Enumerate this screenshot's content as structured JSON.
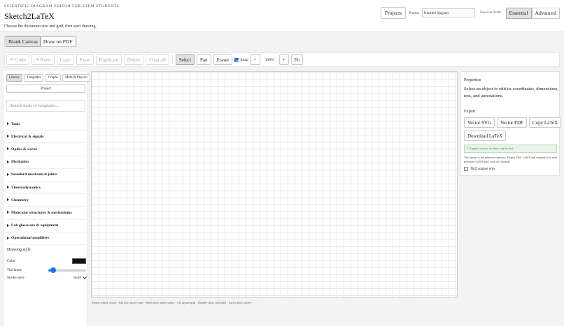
{
  "header": {
    "eyebrow": "SCIENTIFIC DIAGRAM EDITOR FOR STEM STUDENTS",
    "title": "Sketch2LaTeX",
    "instruction": "Choose the document size and grid, then start drawing.",
    "projects_button": "Projects",
    "project_label": "Project",
    "project_name": "Untitled diagram",
    "saved_status": "Saved at 01:00",
    "mode_essential": "Essential",
    "mode_advanced": "Advanced"
  },
  "canvas_mode": {
    "tabs": [
      "Blank Canvas",
      "Draw on PDF"
    ],
    "selected": "Blank Canvas"
  },
  "toolbar": {
    "undo": "↶ Undo",
    "redo": "↷ Redo",
    "copy": "Copy",
    "paste": "Paste",
    "duplicate": "Duplicate",
    "delete": "Delete",
    "clear_all": "Clear all",
    "select": "Select",
    "pan": "Pan",
    "eraser": "Eraser",
    "snap_label": "Snap",
    "snap_checked": true,
    "zoom_out": "−",
    "zoom_level": "100%",
    "zoom_in": "+",
    "fit": "Fit"
  },
  "sidebar": {
    "tabs": [
      "Library",
      "Templates",
      "Graphs",
      "Math & Physics"
    ],
    "project_tab": "Project",
    "search_placeholder": "Search tools or templates…",
    "categories": [
      "Tools",
      "Electrical & signals",
      "Optics & waves",
      "Mechanics",
      "Standard mechanical joints",
      "Thermodynamics",
      "Chemistry",
      "Molecular structures & mechanisms",
      "Lab glassware & equipment",
      "Operational amplifiers"
    ],
    "drawing_style": {
      "title": "Drawing style",
      "color_label": "Color",
      "color_value": "#111111",
      "thickness_label": "Thickness",
      "thickness_fraction": 0.13,
      "stroke_label": "Stroke style",
      "stroke_value": "Solid"
    }
  },
  "canvas": {
    "hint": "Mouse wheel: zoom · Pan tool: move view · Shift-click: multi-select · Alt: ignore grid · Double-click: edit label · Arrow keys: move"
  },
  "properties": {
    "title": "Properties",
    "placeholder": "Select an object to edit its coordinates, dimensions, text, and annotations.",
    "export_title": "Export",
    "export_buttons": [
      "Vector SVG",
      "Vector PDF",
      "Copy LaTeX",
      "Download LaTeX"
    ],
    "status_message": "✓ Empty canvas: no data can be lost.",
    "note": "The canvas is the reference preview. Export TikZ LaTeX and compile it in your preferred LaTeX tool, such as Overleaf.",
    "tikz_only_label": "TikZ snippet only",
    "tikz_only_checked": false
  }
}
